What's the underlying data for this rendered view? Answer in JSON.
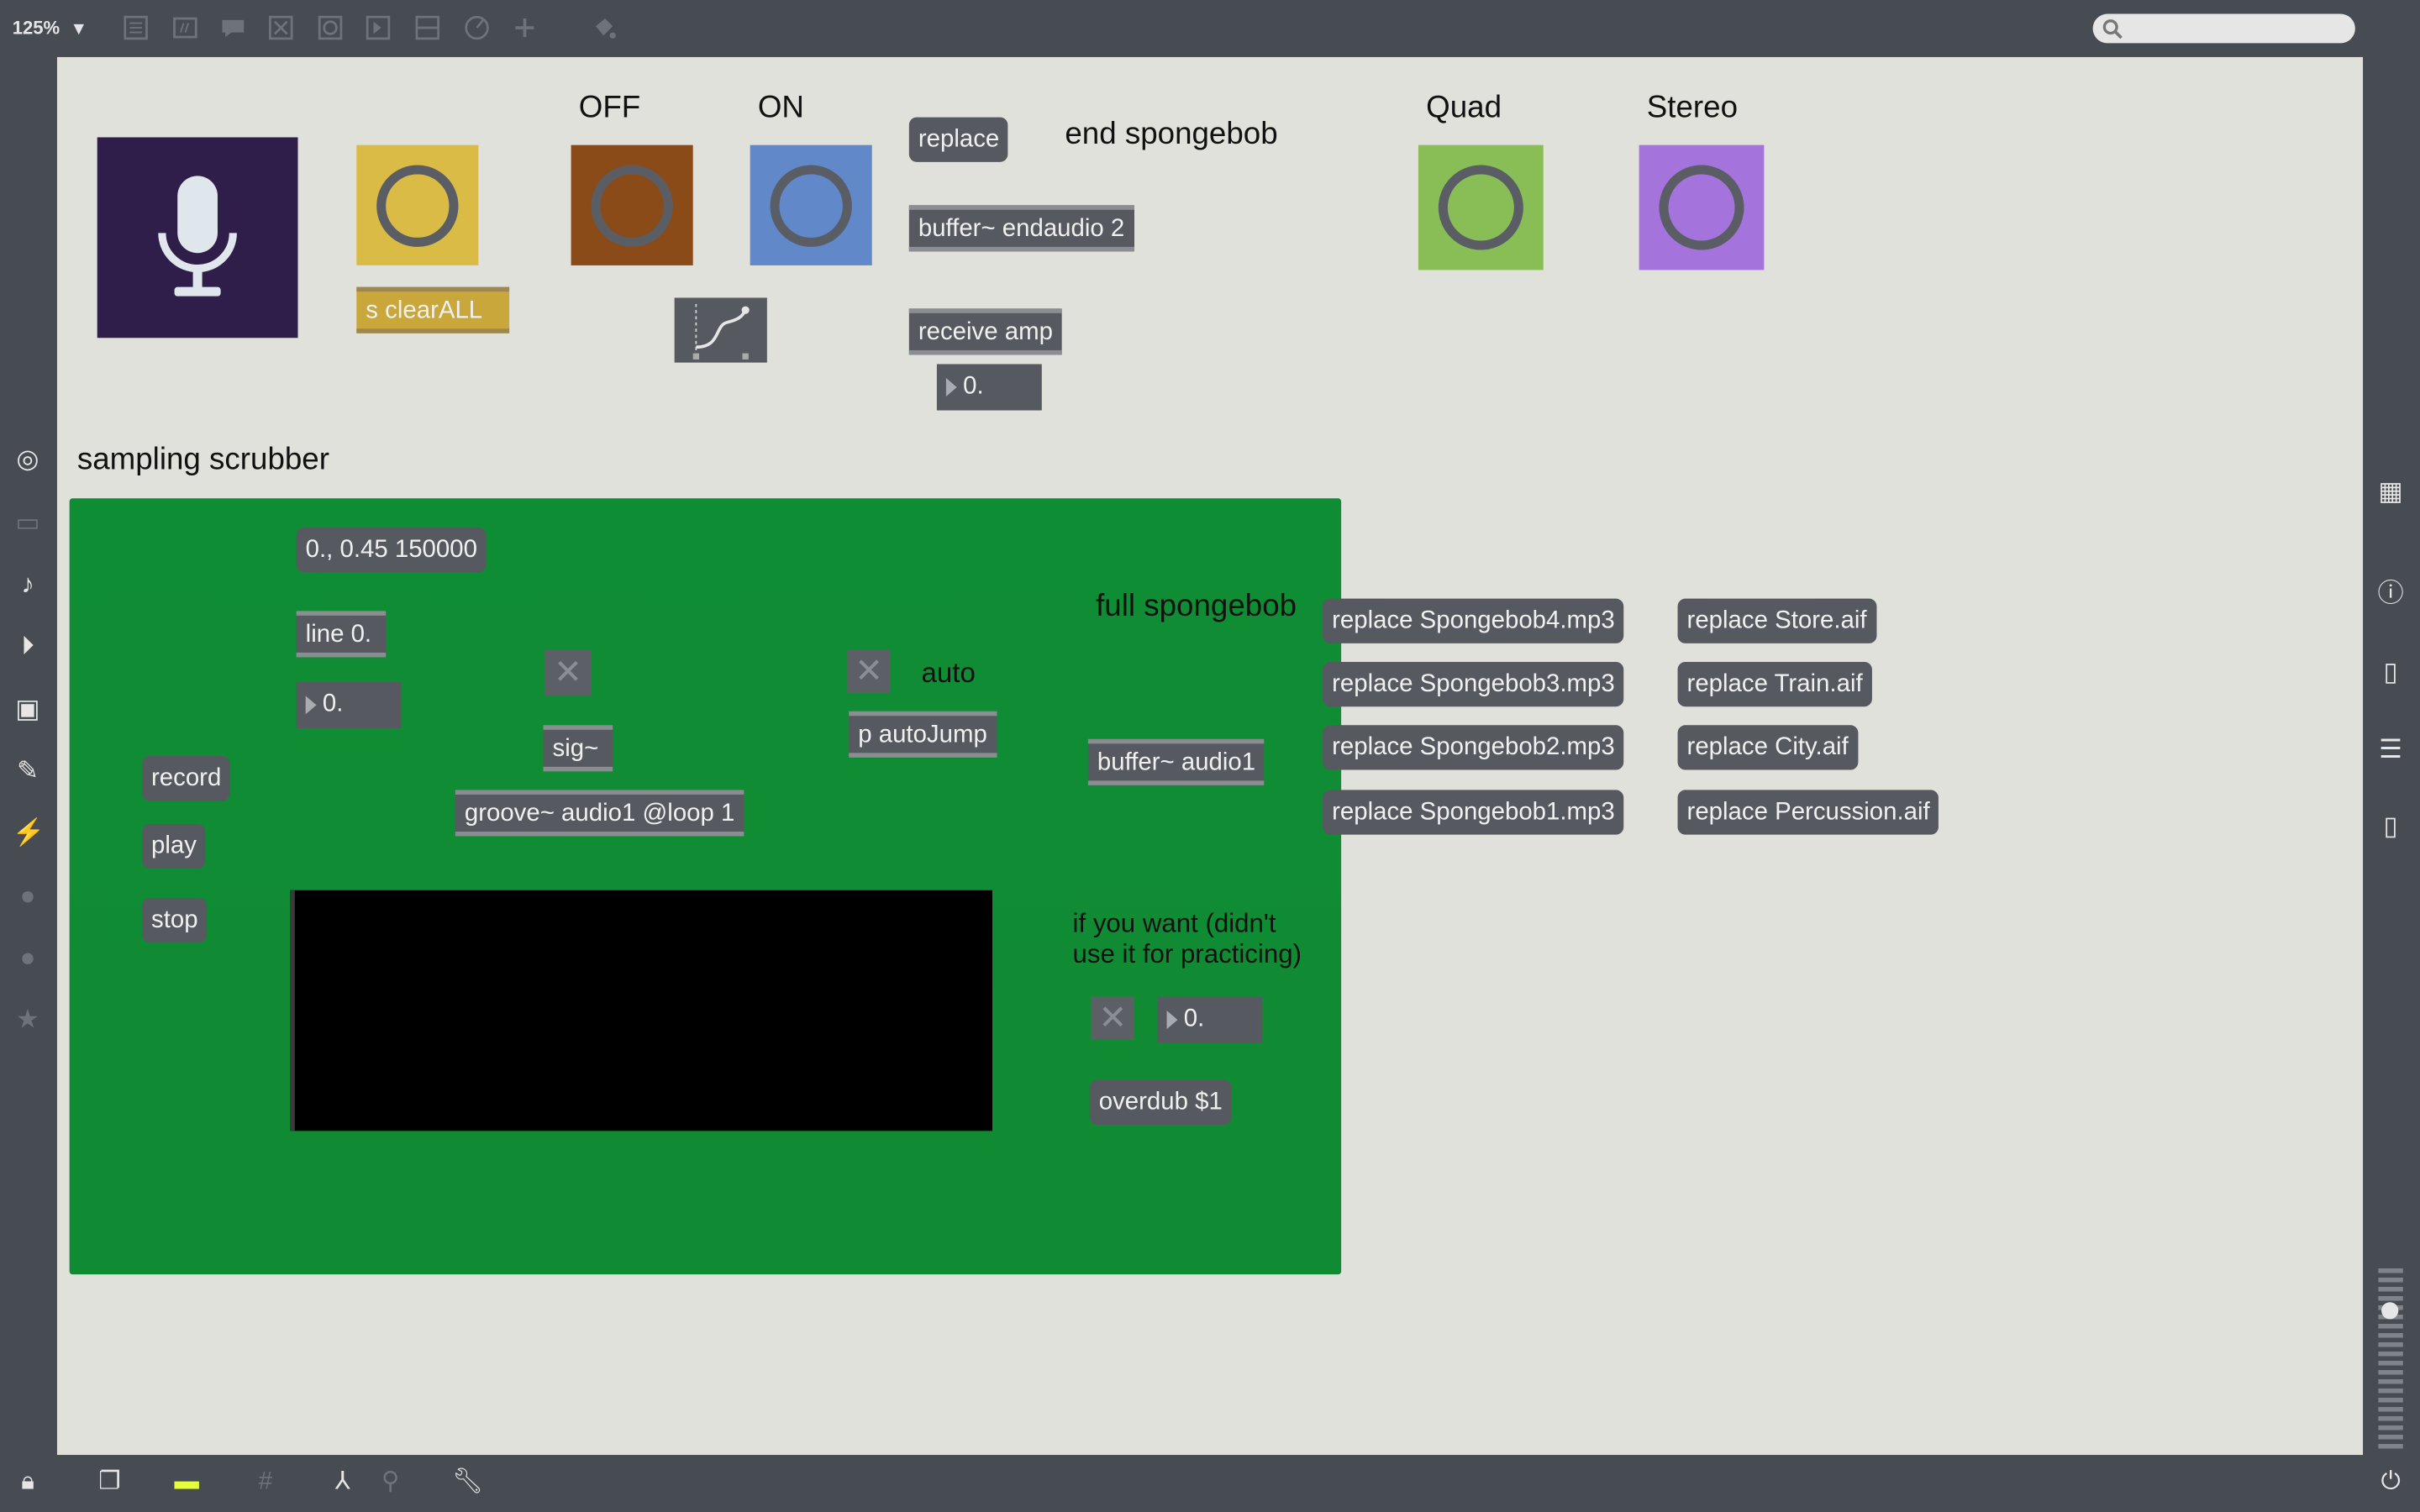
{
  "toolbar": {
    "zoom": "125%",
    "zoom_caret": "▾"
  },
  "canvas": {
    "labels": {
      "off": "OFF",
      "on": "ON",
      "end_spongebob": "end spongebob",
      "quad": "Quad",
      "stereo": "Stereo",
      "sampling_scrubber": "sampling scrubber",
      "full_spongebob": "full spongebob",
      "auto": "auto",
      "if_you_want": "if you want (didn't use it for practicing)"
    },
    "objects": {
      "replace": "replace",
      "buffer_endaudio": "buffer~ endaudio 2",
      "receive_amp": "receive amp",
      "amp_number": "0.",
      "clear_all": "s clearALL",
      "line_msg": "0., 0.45 150000",
      "line_obj": "line 0.",
      "line_number": "0.",
      "sig": "sig~",
      "groove": "groove~ audio1 @loop 1",
      "autojump": "p autoJump",
      "buffer_audio1": "buffer~ audio1",
      "record": "record",
      "play": "play",
      "stop": "stop",
      "overdub_number": "0.",
      "overdub": "overdub $1"
    },
    "replace_messages": [
      "replace Spongebob4.mp3",
      "replace Spongebob3.mp3",
      "replace Spongebob2.mp3",
      "replace Spongebob1.mp3",
      "replace Store.aif",
      "replace Train.aif",
      "replace City.aif",
      "replace Percussion.aif"
    ]
  },
  "colors": {
    "canvas": "#e1e1dc",
    "panel_green": "#0f8d34",
    "mic_bg": "#2f1d4a",
    "yellow_button": "#d9bb45",
    "off_button": "#8a4b18",
    "on_button": "#6188c9",
    "quad_button": "#89be57",
    "stereo_button": "#a473db"
  },
  "icons": {
    "mic": "microphone-icon",
    "search": "search-icon"
  }
}
